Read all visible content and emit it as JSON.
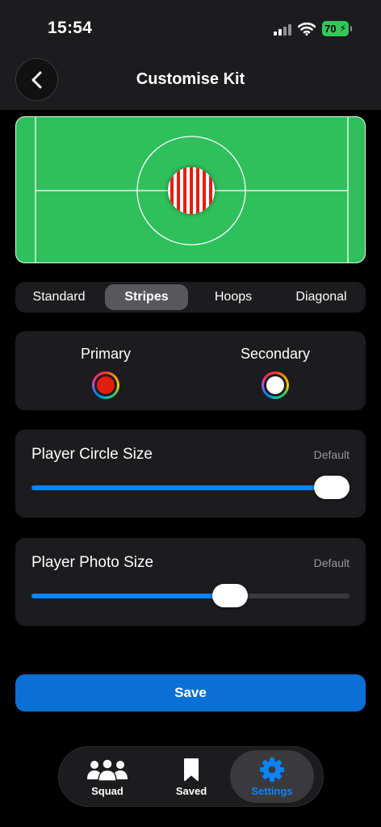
{
  "status_bar": {
    "time": "15:54",
    "battery": "70"
  },
  "header": {
    "title": "Customise Kit",
    "back_icon": "chevron-left-icon"
  },
  "kit_styles": {
    "options": [
      "Standard",
      "Stripes",
      "Hoops",
      "Diagonal"
    ],
    "selected": "Stripes"
  },
  "colors": {
    "primary": {
      "label": "Primary",
      "value": "#e31e10"
    },
    "secondary": {
      "label": "Secondary",
      "value": "#ffffff"
    }
  },
  "sliders": {
    "circle": {
      "title": "Player Circle Size",
      "default_label": "Default",
      "value_fraction": 1.0
    },
    "photo": {
      "title": "Player Photo Size",
      "default_label": "Default",
      "value_fraction": 0.64
    }
  },
  "save_label": "Save",
  "tab_bar": {
    "squad": {
      "label": "Squad",
      "icon": "people-icon"
    },
    "saved": {
      "label": "Saved",
      "icon": "bookmark-icon"
    },
    "settings": {
      "label": "Settings",
      "icon": "gear-icon"
    },
    "active": "settings"
  },
  "theme": {
    "pitch": "#2fbf5b",
    "accent": "#0a84ff",
    "card": "#1c1c1e"
  }
}
